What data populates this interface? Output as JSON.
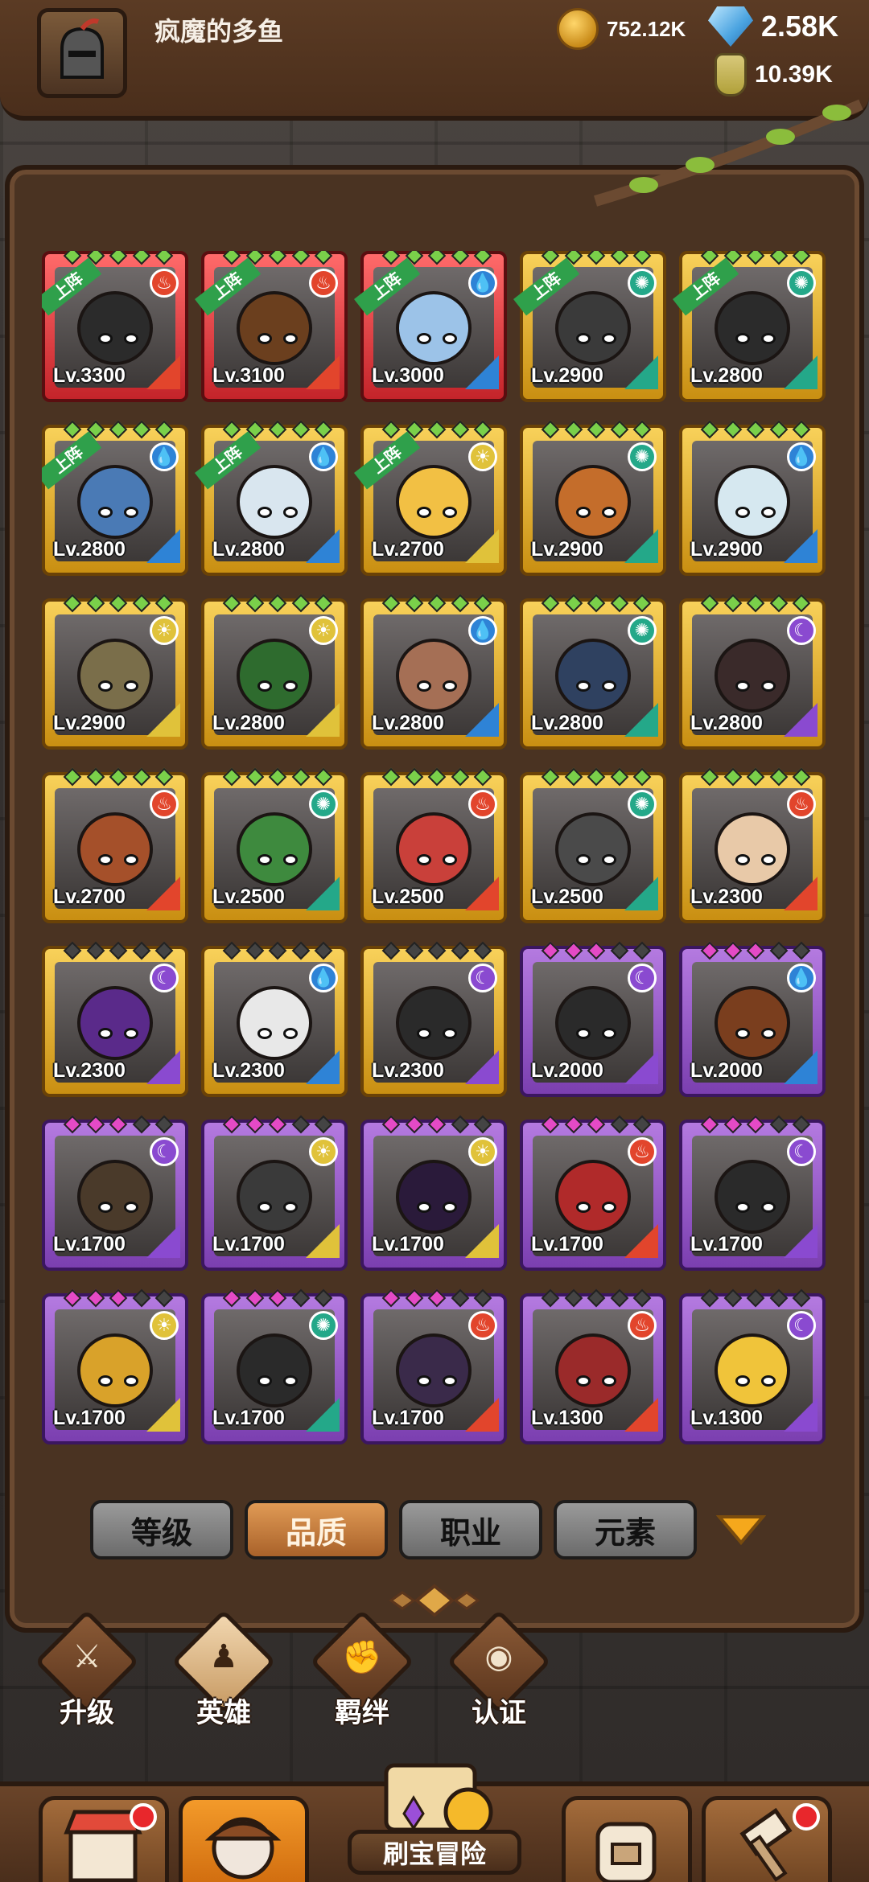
{
  "header": {
    "player_name": "疯魔的多鱼",
    "gold": "752.12K",
    "gems": "2.58K",
    "potions": "10.39K"
  },
  "heroes": [
    {
      "level": "Lv.3300",
      "rarity": "red",
      "deployed": true,
      "element": "fire",
      "pips": "green"
    },
    {
      "level": "Lv.3100",
      "rarity": "red",
      "deployed": true,
      "element": "fire",
      "pips": "green"
    },
    {
      "level": "Lv.3000",
      "rarity": "red",
      "deployed": true,
      "element": "water",
      "pips": "green"
    },
    {
      "level": "Lv.2900",
      "rarity": "gold",
      "deployed": true,
      "element": "wind",
      "pips": "green"
    },
    {
      "level": "Lv.2800",
      "rarity": "gold",
      "deployed": true,
      "element": "wind",
      "pips": "green"
    },
    {
      "level": "Lv.2800",
      "rarity": "gold",
      "deployed": true,
      "element": "water",
      "pips": "green"
    },
    {
      "level": "Lv.2800",
      "rarity": "gold",
      "deployed": true,
      "element": "water",
      "pips": "green"
    },
    {
      "level": "Lv.2700",
      "rarity": "gold",
      "deployed": true,
      "element": "light",
      "pips": "green"
    },
    {
      "level": "Lv.2900",
      "rarity": "gold",
      "deployed": false,
      "element": "wind",
      "pips": "green"
    },
    {
      "level": "Lv.2900",
      "rarity": "gold",
      "deployed": false,
      "element": "water",
      "pips": "green"
    },
    {
      "level": "Lv.2900",
      "rarity": "gold",
      "deployed": false,
      "element": "light",
      "pips": "green"
    },
    {
      "level": "Lv.2800",
      "rarity": "gold",
      "deployed": false,
      "element": "light",
      "pips": "green"
    },
    {
      "level": "Lv.2800",
      "rarity": "gold",
      "deployed": false,
      "element": "water",
      "pips": "green"
    },
    {
      "level": "Lv.2800",
      "rarity": "gold",
      "deployed": false,
      "element": "wind",
      "pips": "green"
    },
    {
      "level": "Lv.2800",
      "rarity": "gold",
      "deployed": false,
      "element": "dark",
      "pips": "green"
    },
    {
      "level": "Lv.2700",
      "rarity": "gold",
      "deployed": false,
      "element": "fire",
      "pips": "green"
    },
    {
      "level": "Lv.2500",
      "rarity": "gold",
      "deployed": false,
      "element": "wind",
      "pips": "green"
    },
    {
      "level": "Lv.2500",
      "rarity": "gold",
      "deployed": false,
      "element": "fire",
      "pips": "green"
    },
    {
      "level": "Lv.2500",
      "rarity": "gold",
      "deployed": false,
      "element": "wind",
      "pips": "green"
    },
    {
      "level": "Lv.2300",
      "rarity": "gold",
      "deployed": false,
      "element": "fire",
      "pips": "green"
    },
    {
      "level": "Lv.2300",
      "rarity": "gold",
      "deployed": false,
      "element": "dark",
      "pips": "gray"
    },
    {
      "level": "Lv.2300",
      "rarity": "gold",
      "deployed": false,
      "element": "water",
      "pips": "gray"
    },
    {
      "level": "Lv.2300",
      "rarity": "gold",
      "deployed": false,
      "element": "dark",
      "pips": "gray"
    },
    {
      "level": "Lv.2000",
      "rarity": "purple",
      "deployed": false,
      "element": "dark",
      "pips": "pink"
    },
    {
      "level": "Lv.2000",
      "rarity": "purple",
      "deployed": false,
      "element": "water",
      "pips": "pink"
    },
    {
      "level": "Lv.1700",
      "rarity": "purple",
      "deployed": false,
      "element": "dark",
      "pips": "pink"
    },
    {
      "level": "Lv.1700",
      "rarity": "purple",
      "deployed": false,
      "element": "light",
      "pips": "pink"
    },
    {
      "level": "Lv.1700",
      "rarity": "purple",
      "deployed": false,
      "element": "light",
      "pips": "pink"
    },
    {
      "level": "Lv.1700",
      "rarity": "purple",
      "deployed": false,
      "element": "fire",
      "pips": "pink"
    },
    {
      "level": "Lv.1700",
      "rarity": "purple",
      "deployed": false,
      "element": "dark",
      "pips": "pink"
    },
    {
      "level": "Lv.1700",
      "rarity": "purple",
      "deployed": false,
      "element": "light",
      "pips": "pink"
    },
    {
      "level": "Lv.1700",
      "rarity": "purple",
      "deployed": false,
      "element": "wind",
      "pips": "pink"
    },
    {
      "level": "Lv.1700",
      "rarity": "purple",
      "deployed": false,
      "element": "fire",
      "pips": "pink"
    },
    {
      "level": "Lv.1300",
      "rarity": "purple",
      "deployed": false,
      "element": "fire",
      "pips": "gray"
    },
    {
      "level": "Lv.1300",
      "rarity": "purple",
      "deployed": false,
      "element": "dark",
      "pips": "gray"
    }
  ],
  "deployed_label": "上阵",
  "filters": {
    "tabs": [
      "等级",
      "品质",
      "职业",
      "元素"
    ],
    "active": "品质"
  },
  "subnav": [
    {
      "label": "升级",
      "icon": "sword-icon"
    },
    {
      "label": "英雄",
      "icon": "hero-icon"
    },
    {
      "label": "羁绊",
      "icon": "fist-icon"
    },
    {
      "label": "认证",
      "icon": "eye-icon"
    }
  ],
  "bottomnav": {
    "adventure_label": "刷宝冒险"
  },
  "colors": {
    "fire": "#e2452c",
    "water": "#2e83d6",
    "wind": "#24a889",
    "light": "#e0c23a",
    "dark": "#8a4ad0"
  }
}
